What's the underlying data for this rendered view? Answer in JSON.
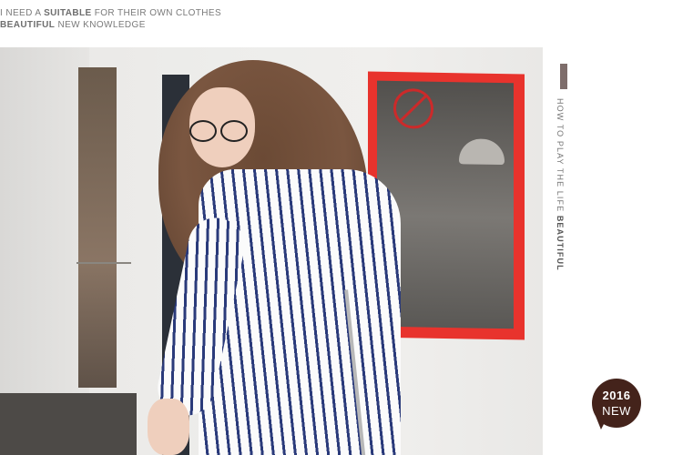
{
  "header": {
    "line1": {
      "pre": "I NEED A ",
      "bold": "SUITABLE",
      "post": " FOR THEIR OWN CLOTHES"
    },
    "line2": {
      "bold": "BEAUTIFUL",
      "post": " NEW KNOWLEDGE"
    }
  },
  "side": {
    "vertical_text": "HOW TO PLAY THE LIFE ",
    "vertical_bold": "BEAUTIFUL",
    "accent_color": "#7e6d6b"
  },
  "badge": {
    "year": "2016",
    "label": "NEW",
    "color": "#44231b"
  },
  "photo": {
    "subject": "woman-in-striped-shirt",
    "mirror_frame_color": "#e8332d",
    "stripe_color": "#2a3a7a"
  }
}
